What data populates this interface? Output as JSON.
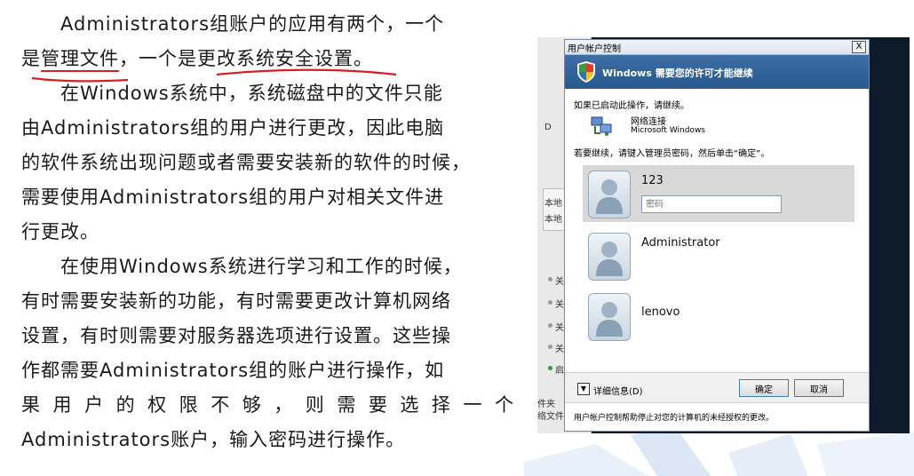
{
  "article": {
    "p1_line1": "Administrators组账户的应用有两个，一个",
    "p1_a": "是",
    "p1_u1": "管理文件",
    "p1_b": "，一个是",
    "p1_u2": "更改系统安全设置",
    "p1_c": "。",
    "p2_lines": [
      "在Windows系统中，系统磁盘中的文件只能",
      "由Administrators组的用户进行更改，因此电脑",
      "的软件系统出现问题或者需要安装新的软件的时候，",
      "需要使用Administrators组的用户对相关文件进",
      "行更改。"
    ],
    "p3_lines": [
      "在使用Windows系统进行学习和工作的时候，",
      "有时需要安装新的功能，有时需要更改计算机网络",
      "设置，有时则需要对服务器选项进行设置。这些操",
      "作都需要Administrators组的账户进行操作，如",
      "果用户的权限不够，则需要选择一个",
      "Administrators账户，输入密码进行操作。"
    ]
  },
  "background_window": {
    "fragments": [
      "D",
      "本地",
      "本地",
      "关",
      "关",
      "关",
      "关",
      "启",
      "件夹",
      "络文件"
    ]
  },
  "dialog": {
    "title": "用户帐户控制",
    "close_label": "X",
    "banner_text": "Windows 需要您的许可才能继续",
    "intro": "如果已启动此操作，请继续。",
    "program_name": "网络连接",
    "program_publisher": "Microsoft Windows",
    "instruction": "若要继续，请键入管理员密码，然后单击“确定”。",
    "users": [
      {
        "name": "123",
        "selected": true
      },
      {
        "name": "Administrator",
        "selected": false
      },
      {
        "name": "lenovo",
        "selected": false
      }
    ],
    "password_placeholder": "密码",
    "details_label": "详细信息(D)",
    "ok_label": "确定",
    "cancel_label": "取消",
    "status_text": "用户帐户控制帮助停止对您的计算机的未经授权的更改。"
  },
  "colors": {
    "underline_red": "#d42020",
    "banner_blue": "#2f5f96"
  }
}
